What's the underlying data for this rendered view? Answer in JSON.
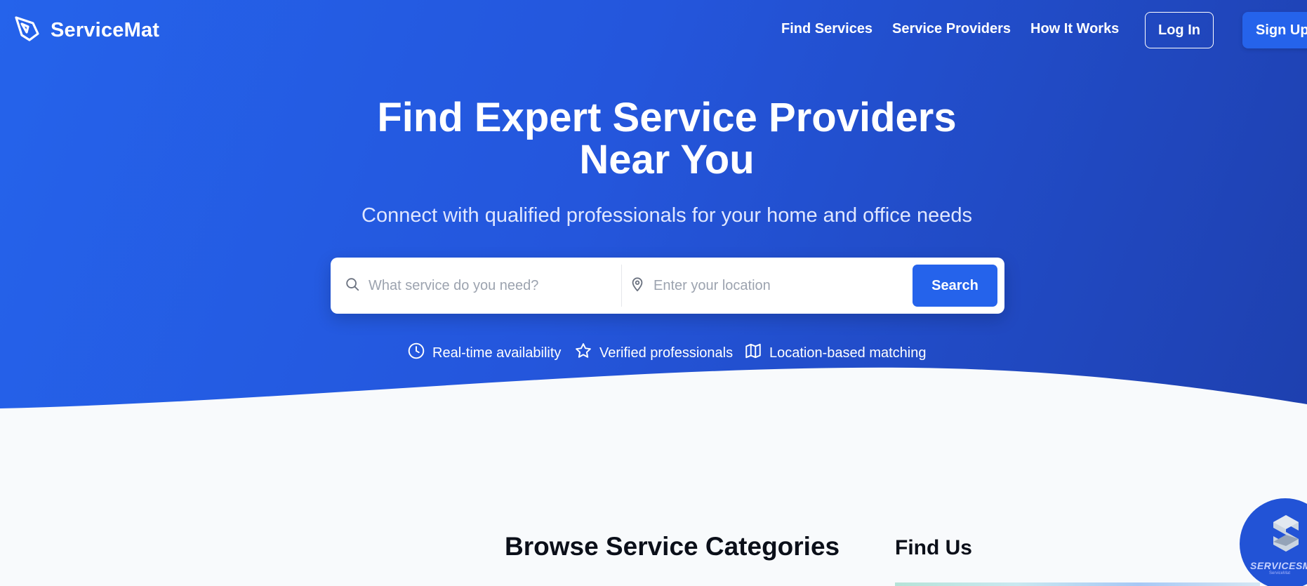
{
  "nav": {
    "brand": "ServiceMat",
    "links": [
      "Find Services",
      "Service Providers",
      "How It Works"
    ],
    "login": "Log In",
    "signup": "Sign Up"
  },
  "hero": {
    "title_line1": "Find Expert Service Providers",
    "title_line2": "Near You",
    "subtitle": "Connect with qualified professionals for your home and office needs",
    "search": {
      "service_placeholder": "What service do you need?",
      "location_placeholder": "Enter your location",
      "button": "Search"
    },
    "features": [
      {
        "icon": "clock-icon",
        "label": "Real-time availability"
      },
      {
        "icon": "star-icon",
        "label": "Verified professionals"
      },
      {
        "icon": "map-icon",
        "label": "Location-based matching"
      }
    ]
  },
  "sections": {
    "categories_title": "Browse Service Categories",
    "find_us_title": "Find Us"
  },
  "floating_badge": {
    "text": "SERVICESM",
    "subtext": "ServiceMat"
  },
  "colors": {
    "primary": "#2563eb",
    "primary_dark": "#1e40af",
    "background": "#f8fafc",
    "heading": "#0b0f19"
  }
}
